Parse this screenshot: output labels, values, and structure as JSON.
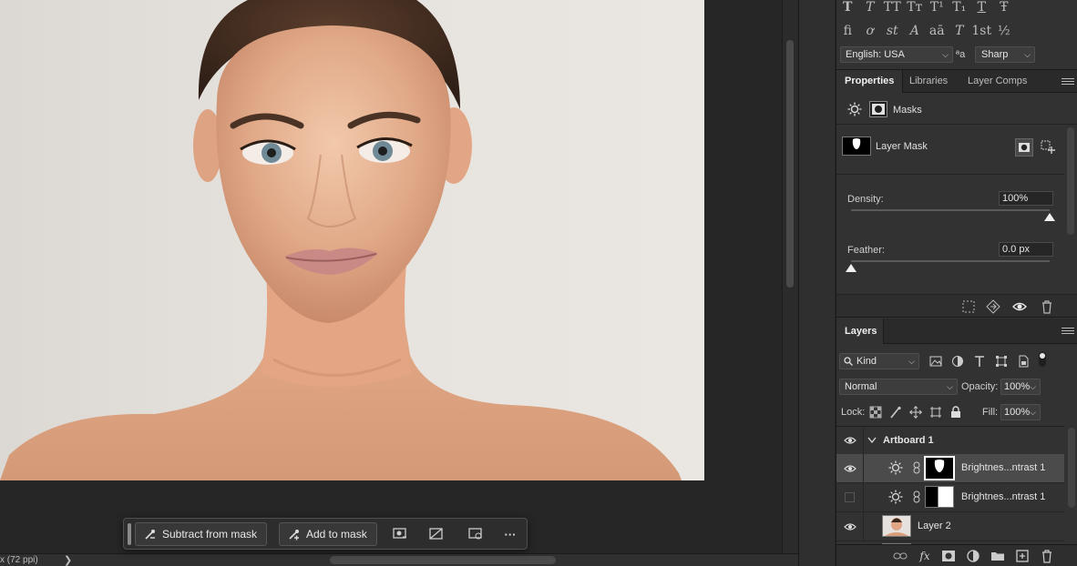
{
  "status": {
    "zoom_text": "x (72 ppi)",
    "arrow": "❯"
  },
  "taskbar": {
    "subtract_label": "Subtract from mask",
    "add_label": "Add to mask",
    "more_label": "···"
  },
  "character": {
    "row1": [
      "T",
      "T",
      "TT",
      "Tт",
      "T¹",
      "T₁",
      "T",
      "Ŧ"
    ],
    "row2": [
      "fi",
      "ơ",
      "st",
      "A",
      "aā",
      "T",
      "1st",
      "½"
    ],
    "language": "English: USA",
    "aa_icon": "ªa",
    "antialias": "Sharp"
  },
  "properties": {
    "tabs": [
      "Properties",
      "Libraries",
      "Layer Comps"
    ],
    "masks_label": "Masks",
    "layer_mask_label": "Layer Mask",
    "density_label": "Density:",
    "density_value": "100%",
    "density_level": 1.0,
    "feather_label": "Feather:",
    "feather_value": "0.0 px",
    "feather_level": 0.0
  },
  "layers": {
    "tab_label": "Layers",
    "kind_label": "Kind",
    "blend_mode": "Normal",
    "opacity_label": "Opacity:",
    "opacity_value": "100%",
    "lock_label": "Lock:",
    "fill_label": "Fill:",
    "fill_value": "100%",
    "items": [
      {
        "name": "Artboard 1",
        "type": "artboard",
        "visible": true
      },
      {
        "name": "Brightnes...ntrast 1",
        "type": "adjustment",
        "visible": true,
        "selected": true
      },
      {
        "name": "Brightnes...ntrast 1",
        "type": "adjustment",
        "visible": false
      },
      {
        "name": "Layer 2",
        "type": "pixel",
        "visible": true
      }
    ]
  },
  "colors": {
    "panel_bg": "#323232",
    "canvas_bg": "#262626",
    "selected_row": "#4b4b4b"
  }
}
